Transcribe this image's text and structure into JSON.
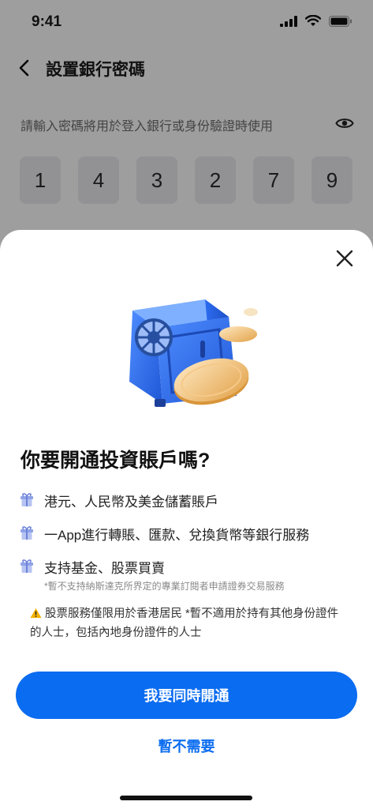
{
  "status_bar": {
    "time": "9:41"
  },
  "nav": {
    "title": "設置銀行密碼"
  },
  "password": {
    "hint": "請輸入密碼將用於登入銀行或身份驗證時使用",
    "digits": [
      "1",
      "4",
      "3",
      "2",
      "7",
      "9"
    ]
  },
  "sheet": {
    "headline": "你要開通投資賬戶嗎?",
    "features": [
      {
        "text": "港元、人民幣及美金儲蓄賬戶",
        "sub": ""
      },
      {
        "text": "一App進行轉賬、匯款、兌換貨幣等銀行服務",
        "sub": ""
      },
      {
        "text": "支持基金、股票買賣",
        "sub": "*暫不支持納斯達克所界定的專業訂閱者申請證券交易服務"
      }
    ],
    "notice": "股票服務僅限用於香港居民 *暫不適用於持有其他身份證件的人士，包括內地身份證件的人士",
    "primary_button": "我要同時開通",
    "secondary_button": "暫不需要"
  },
  "colors": {
    "accent": "#0a6cf0",
    "overlay": "rgba(0,0,0,0.38)",
    "gift_icon": "#8fa3e8",
    "warning": "#f5b400"
  },
  "icons": [
    "back-arrow-icon",
    "eye-icon",
    "close-icon",
    "gift-icon",
    "warning-icon",
    "safe-illustration"
  ]
}
